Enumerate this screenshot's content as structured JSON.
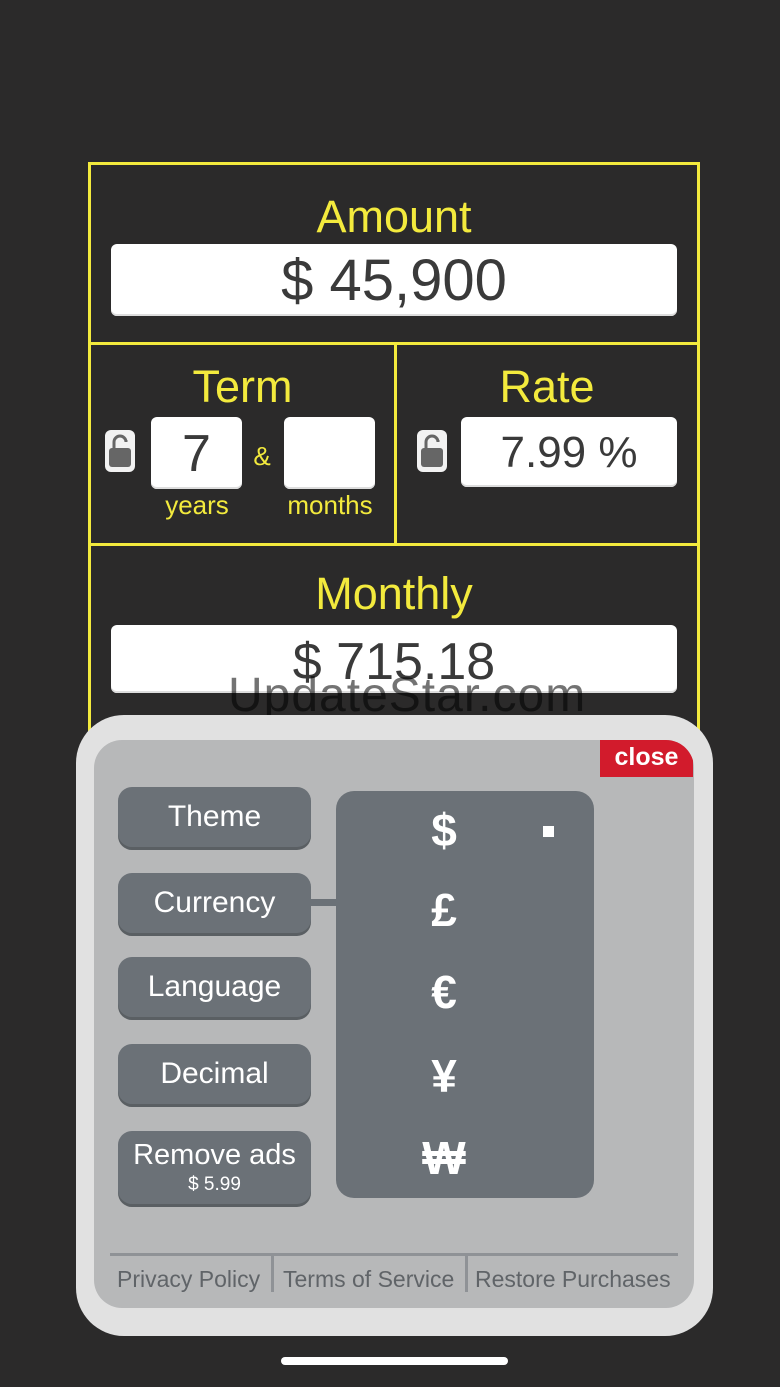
{
  "calculator": {
    "amount": {
      "label": "Amount",
      "value": "$ 45,900"
    },
    "term": {
      "label": "Term",
      "years_value": "7",
      "ampersand": "&",
      "months_value": "",
      "years_label": "years",
      "months_label": "months"
    },
    "rate": {
      "label": "Rate",
      "value": "7.99 %"
    },
    "monthly": {
      "label": "Monthly",
      "value": "$ 715.18"
    }
  },
  "watermark": "UpdateStar.com",
  "settings": {
    "close_label": "close",
    "options": [
      "Theme",
      "Currency",
      "Language",
      "Decimal",
      "Remove ads"
    ],
    "remove_ads_price": "$ 5.99",
    "currencies": [
      "$",
      "£",
      "€",
      "¥",
      "₩"
    ],
    "selected_currency": "$",
    "footer": {
      "privacy": "Privacy Policy",
      "terms": "Terms of Service",
      "restore": "Restore Purchases"
    }
  },
  "colors": {
    "accent": "#f3ea3d",
    "background": "#2b2a2a",
    "button": "#6b7177",
    "close": "#d21b2c"
  }
}
